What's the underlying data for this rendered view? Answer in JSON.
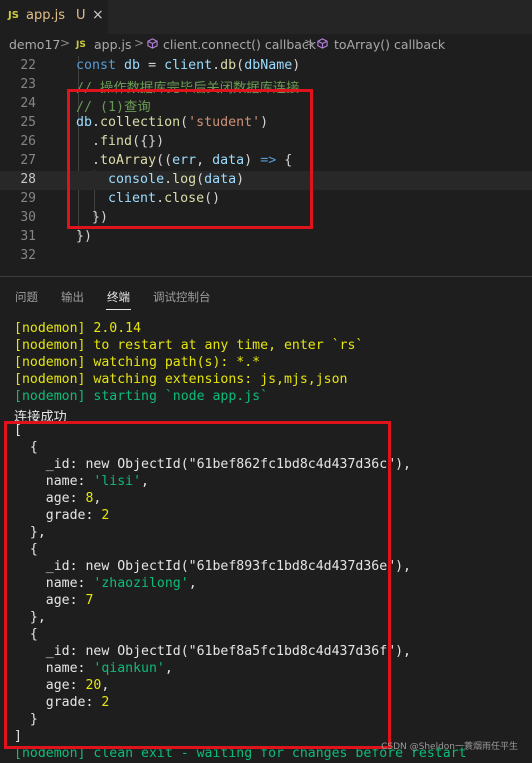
{
  "tab": {
    "icon_label": "JS",
    "filename": "app.js",
    "modified": "U",
    "close": "×"
  },
  "breadcrumb": {
    "folder": "demo17",
    "file": "app.js",
    "fn1": "client.connect() callback",
    "fn2": "toArray() callback"
  },
  "editor": {
    "lines": [
      {
        "n": "22",
        "parts": [
          [
            "kw",
            "const "
          ],
          [
            "var",
            "db"
          ],
          [
            "pl",
            " = "
          ],
          [
            "var",
            "client"
          ],
          [
            "pl",
            "."
          ],
          [
            "fn",
            "db"
          ],
          [
            "pl",
            "("
          ],
          [
            "var",
            "dbName"
          ],
          [
            "pl",
            ")"
          ]
        ]
      },
      {
        "n": "23",
        "parts": [
          [
            "cm",
            "// 操作数据库完毕后关闭数据库连接"
          ]
        ]
      },
      {
        "n": "24",
        "parts": [
          [
            "cm",
            "// (1)查询"
          ]
        ]
      },
      {
        "n": "25",
        "parts": [
          [
            "var",
            "db"
          ],
          [
            "pl",
            "."
          ],
          [
            "fn",
            "collection"
          ],
          [
            "pl",
            "("
          ],
          [
            "str",
            "'student'"
          ],
          [
            "pl",
            ")"
          ]
        ]
      },
      {
        "n": "26",
        "parts": [
          [
            "pl",
            "  ."
          ],
          [
            "fn",
            "find"
          ],
          [
            "pl",
            "({})"
          ]
        ]
      },
      {
        "n": "27",
        "parts": [
          [
            "pl",
            "  ."
          ],
          [
            "fn",
            "toArray"
          ],
          [
            "pl",
            "(("
          ],
          [
            "var",
            "err"
          ],
          [
            "pl",
            ", "
          ],
          [
            "var",
            "data"
          ],
          [
            "pl",
            ") "
          ],
          [
            "kw",
            "=>"
          ],
          [
            "pl",
            " {"
          ]
        ]
      },
      {
        "n": "28",
        "parts": [
          [
            "pl",
            "    "
          ],
          [
            "var",
            "console"
          ],
          [
            "pl",
            "."
          ],
          [
            "fn",
            "log"
          ],
          [
            "pl",
            "("
          ],
          [
            "var",
            "data"
          ],
          [
            "pl",
            ")"
          ]
        ]
      },
      {
        "n": "29",
        "parts": [
          [
            "pl",
            "    "
          ],
          [
            "var",
            "client"
          ],
          [
            "pl",
            "."
          ],
          [
            "fn",
            "close"
          ],
          [
            "pl",
            "()"
          ]
        ]
      },
      {
        "n": "30",
        "parts": [
          [
            "pl",
            "  })"
          ]
        ]
      },
      {
        "n": "31",
        "parts": [
          [
            "pl",
            "})"
          ]
        ]
      },
      {
        "n": "32",
        "parts": []
      }
    ]
  },
  "panel": {
    "tabs": [
      "问题",
      "输出",
      "终端",
      "调试控制台"
    ],
    "active_tab": "终端"
  },
  "terminal": {
    "lines": [
      [
        [
          "t-yel",
          "[nodemon] 2.0.14"
        ]
      ],
      [
        [
          "t-yel",
          "[nodemon] to restart at any time, enter `rs`"
        ]
      ],
      [
        [
          "t-yel",
          "[nodemon] watching path(s): *.*"
        ]
      ],
      [
        [
          "t-yel",
          "[nodemon] watching extensions: js,mjs,json"
        ]
      ],
      [
        [
          "t-grn",
          "[nodemon] starting `node app.js`"
        ]
      ],
      [
        [
          "t-cjk",
          "连接成功"
        ]
      ],
      [
        [
          "t-wht",
          "["
        ]
      ],
      [
        [
          "t-wht",
          "  {"
        ]
      ],
      [
        [
          "t-wht",
          "    _id: new ObjectId(\"61bef862fc1bd8c4d437d36c\"),"
        ]
      ],
      [
        [
          "t-wht",
          "    name: "
        ],
        [
          "t-str",
          "'lisi'"
        ],
        [
          "t-wht",
          ","
        ]
      ],
      [
        [
          "t-wht",
          "    age: "
        ],
        [
          "t-num",
          "8"
        ],
        [
          "t-wht",
          ","
        ]
      ],
      [
        [
          "t-wht",
          "    grade: "
        ],
        [
          "t-num",
          "2"
        ]
      ],
      [
        [
          "t-wht",
          "  },"
        ]
      ],
      [
        [
          "t-wht",
          "  {"
        ]
      ],
      [
        [
          "t-wht",
          "    _id: new ObjectId(\"61bef893fc1bd8c4d437d36e\"),"
        ]
      ],
      [
        [
          "t-wht",
          "    name: "
        ],
        [
          "t-str",
          "'zhaozilong'"
        ],
        [
          "t-wht",
          ","
        ]
      ],
      [
        [
          "t-wht",
          "    age: "
        ],
        [
          "t-num",
          "7"
        ]
      ],
      [
        [
          "t-wht",
          "  },"
        ]
      ],
      [
        [
          "t-wht",
          "  {"
        ]
      ],
      [
        [
          "t-wht",
          "    _id: new ObjectId(\"61bef8a5fc1bd8c4d437d36f\"),"
        ]
      ],
      [
        [
          "t-wht",
          "    name: "
        ],
        [
          "t-str",
          "'qiankun'"
        ],
        [
          "t-wht",
          ","
        ]
      ],
      [
        [
          "t-wht",
          "    age: "
        ],
        [
          "t-num",
          "20"
        ],
        [
          "t-wht",
          ","
        ]
      ],
      [
        [
          "t-wht",
          "    grade: "
        ],
        [
          "t-num",
          "2"
        ]
      ],
      [
        [
          "t-wht",
          "  }"
        ]
      ],
      [
        [
          "t-wht",
          "]"
        ]
      ],
      [
        [
          "t-grn",
          "[nodemon] clean exit - waiting for changes before restart"
        ]
      ]
    ]
  },
  "watermark": "CSDN @Sheldon一蓑烟雨任平生",
  "colors": {
    "highlight_box": "#e0121b",
    "editor_bg": "#1e1e1e"
  }
}
